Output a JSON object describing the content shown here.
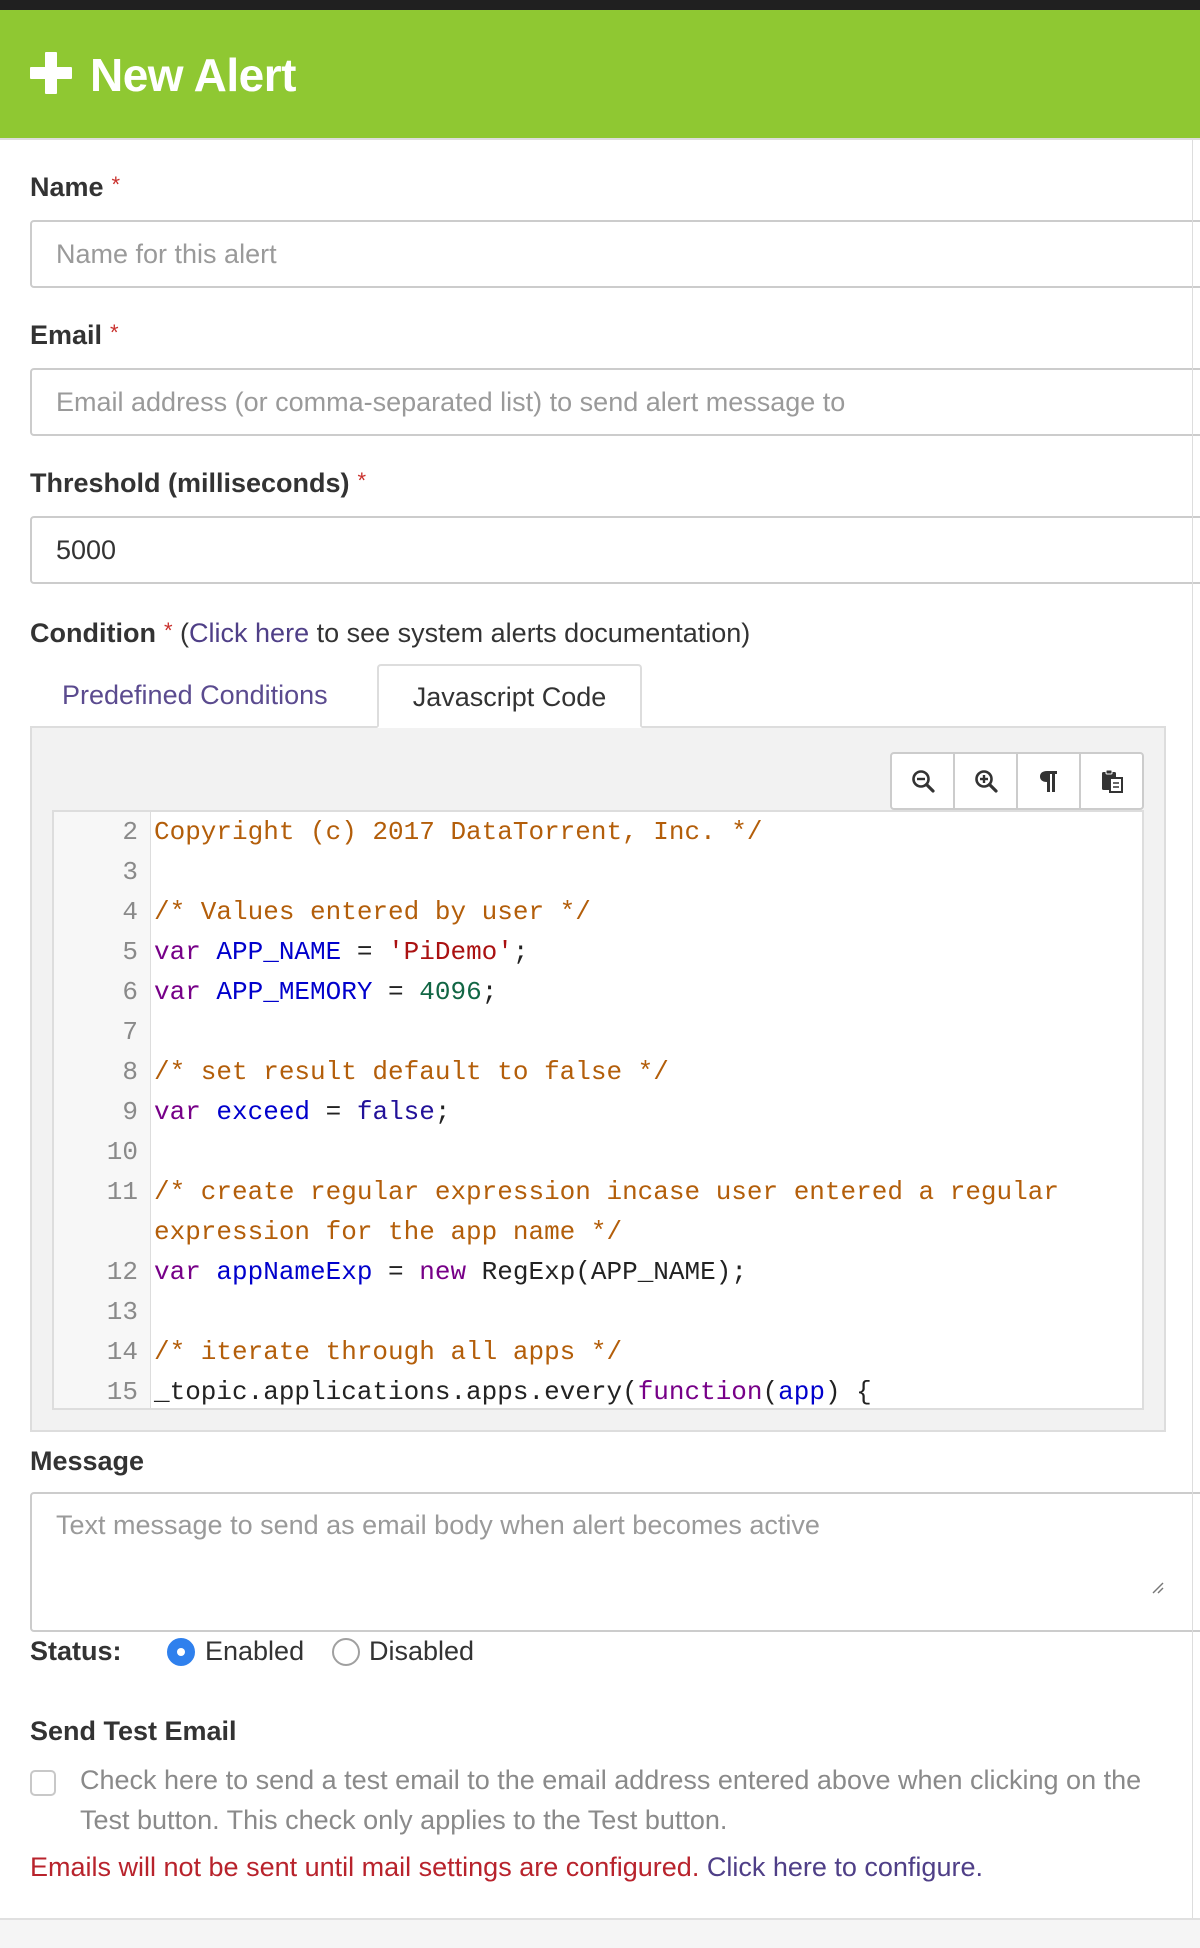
{
  "header": {
    "title": "New Alert"
  },
  "fields": {
    "name": {
      "label": "Name",
      "required": "*",
      "placeholder": "Name for this alert",
      "value": ""
    },
    "email": {
      "label": "Email",
      "required": "*",
      "placeholder": "Email address (or comma-separated list) to send alert message to",
      "value": ""
    },
    "threshold": {
      "label": "Threshold (milliseconds)",
      "required": "*",
      "value": "5000"
    }
  },
  "condition": {
    "label": "Condition",
    "required": "*",
    "doc_prefix": "(",
    "doc_link": "Click here",
    "doc_suffix": " to see system alerts documentation)",
    "tabs": [
      {
        "label": "Predefined Conditions",
        "active": false
      },
      {
        "label": "Javascript Code",
        "active": true
      }
    ],
    "toolbar": [
      {
        "name": "zoom-out-icon"
      },
      {
        "name": "zoom-in-icon"
      },
      {
        "name": "pilcrow-icon"
      },
      {
        "name": "paste-icon"
      }
    ],
    "code_lines": [
      {
        "n": "2",
        "tokens": [
          [
            "comment",
            "Copyright (c) 2017 DataTorrent, Inc. */"
          ]
        ]
      },
      {
        "n": "3",
        "tokens": []
      },
      {
        "n": "4",
        "tokens": [
          [
            "comment",
            "/* Values entered by user */"
          ]
        ]
      },
      {
        "n": "5",
        "tokens": [
          [
            "kw",
            "var"
          ],
          [
            "var",
            " "
          ],
          [
            "def",
            "APP_NAME"
          ],
          [
            "var",
            " = "
          ],
          [
            "str",
            "'PiDemo'"
          ],
          [
            "var",
            ";"
          ]
        ]
      },
      {
        "n": "6",
        "tokens": [
          [
            "kw",
            "var"
          ],
          [
            "var",
            " "
          ],
          [
            "def",
            "APP_MEMORY"
          ],
          [
            "var",
            " = "
          ],
          [
            "num",
            "4096"
          ],
          [
            "var",
            ";"
          ]
        ]
      },
      {
        "n": "7",
        "tokens": []
      },
      {
        "n": "8",
        "tokens": [
          [
            "comment",
            "/* set result default to false */"
          ]
        ]
      },
      {
        "n": "9",
        "tokens": [
          [
            "kw",
            "var"
          ],
          [
            "var",
            " "
          ],
          [
            "def",
            "exceed"
          ],
          [
            "var",
            " = "
          ],
          [
            "atom",
            "false"
          ],
          [
            "var",
            ";"
          ]
        ]
      },
      {
        "n": "10",
        "tokens": []
      },
      {
        "n": "11",
        "tokens": [
          [
            "comment",
            "/* create regular expression incase user entered a regular"
          ]
        ]
      },
      {
        "n": "",
        "tokens": [
          [
            "comment",
            "expression for the app name */"
          ]
        ]
      },
      {
        "n": "12",
        "tokens": [
          [
            "kw",
            "var"
          ],
          [
            "var",
            " "
          ],
          [
            "def",
            "appNameExp"
          ],
          [
            "var",
            " = "
          ],
          [
            "kw",
            "new"
          ],
          [
            "var",
            " RegExp(APP_NAME);"
          ]
        ]
      },
      {
        "n": "13",
        "tokens": []
      },
      {
        "n": "14",
        "tokens": [
          [
            "comment",
            "/* iterate through all apps */"
          ]
        ]
      },
      {
        "n": "15",
        "tokens": [
          [
            "var",
            "_topic.applications.apps.every("
          ],
          [
            "kw",
            "function"
          ],
          [
            "var",
            "("
          ],
          [
            "def",
            "app"
          ],
          [
            "var",
            ") {"
          ]
        ]
      }
    ]
  },
  "message": {
    "label": "Message",
    "placeholder": "Text message to send as email body when alert becomes active",
    "value": ""
  },
  "status": {
    "label": "Status:",
    "options": [
      {
        "label": "Enabled",
        "selected": true
      },
      {
        "label": "Disabled",
        "selected": false
      }
    ]
  },
  "test_email": {
    "heading": "Send Test Email",
    "checkbox_text": "Check here to send a test email to the email address entered above when clicking on the Test button. This check only applies to the Test button.",
    "checked": false
  },
  "mail_warning": {
    "text": "Emails will not be sent until mail settings are configured.",
    "link": "Click here to configure."
  },
  "colors": {
    "header_bg": "#8fc832",
    "link": "#4f3f87",
    "required": "#c9302c",
    "warning": "#b8232c",
    "radio_selected": "#2f80ed"
  }
}
